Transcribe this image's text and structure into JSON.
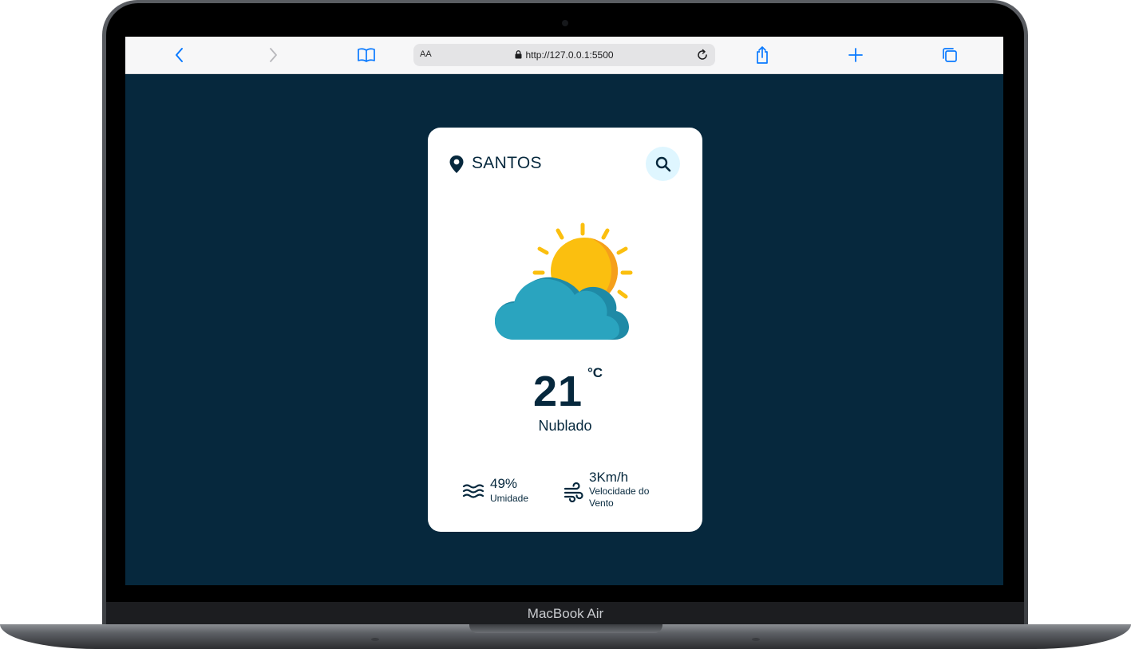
{
  "device": {
    "label": "MacBook Air"
  },
  "browser": {
    "address_prefix": "AA",
    "url": "http://127.0.0.1:5500",
    "icons": [
      "back-icon",
      "forward-icon",
      "bookmarks-icon",
      "lock-icon",
      "reload-icon",
      "share-icon",
      "new-tab-icon",
      "tabs-icon"
    ]
  },
  "weather": {
    "city": "SANTOS",
    "temperature": "21",
    "unit": "°C",
    "description": "Nublado",
    "humidity": {
      "value": "49%",
      "label": "Umidade"
    },
    "wind": {
      "value": "3Km/h",
      "label": "Velocidade do Vento"
    },
    "icons": [
      "location-pin-icon",
      "search-icon",
      "partly-cloudy-icon",
      "humidity-waves-icon",
      "wind-icon"
    ]
  },
  "colors": {
    "page_background": "#06283d",
    "card": "#ffffff",
    "text": "#06283d",
    "search_button": "#dff6ff",
    "browser_accent": "#0a7aff",
    "sun": "#fbbf0f",
    "cloud": "#2aa4bf"
  }
}
